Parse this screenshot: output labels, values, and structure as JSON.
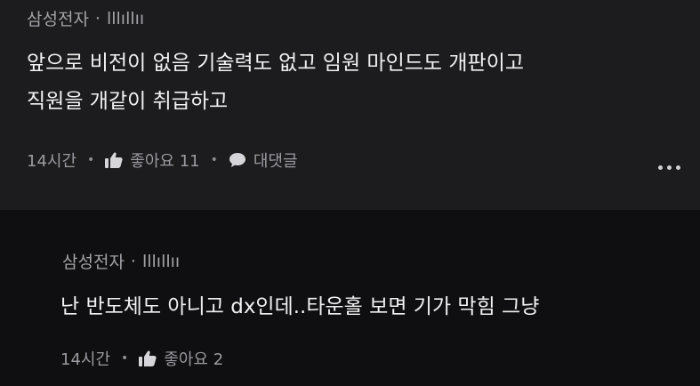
{
  "post": {
    "author": "삼성전자",
    "nickname": "lllıllıı",
    "lines": [
      "앞으로 비전이 없음 기술력도 없고 임원 마인드도 개판이고",
      "직원을 개같이 취급하고"
    ],
    "time": "14시간",
    "like_label": "좋아요 11",
    "reply_label": "대댓글",
    "icons": {
      "like": "thumbs-up-icon",
      "reply": "speech-bubble-icon",
      "more": "more-dots-icon"
    }
  },
  "reply": {
    "author": "삼성전자",
    "nickname": "lllıllıı",
    "lines": [
      "난 반도체도 아니고 dx인데..타운홀 보면 기가 막힘 그냥"
    ],
    "time": "14시간",
    "like_label": "좋아요 2"
  },
  "colors": {
    "post_bg": "#1c1c1f",
    "reply_bg": "#0f0f11",
    "text": "#f1f1f1",
    "muted": "#9a9aa0"
  }
}
